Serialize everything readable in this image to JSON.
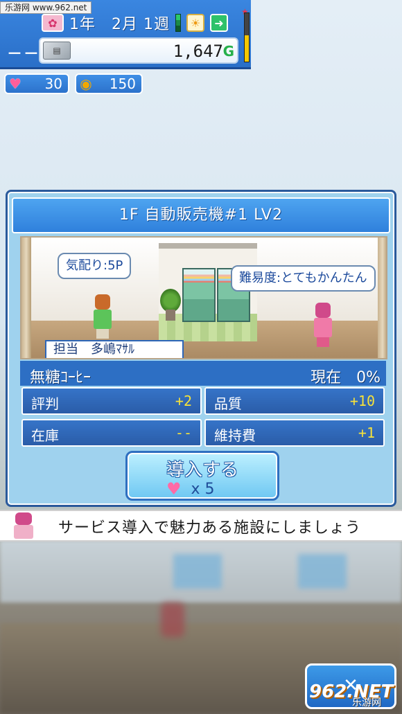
{
  "watermark": {
    "top": "乐游网 www.962.net",
    "bottom": "962.NET",
    "bottom_sub": "乐游网"
  },
  "hud": {
    "date": "1年　2月 1週",
    "money": "1,647",
    "money_unit": "G",
    "dash": "－－",
    "hearts": "30",
    "coins": "150",
    "gauge_level": 0.55
  },
  "dialog": {
    "title": "1F 自動販売機#1 LV2",
    "bubble_staff": "気配り:5P",
    "bubble_customer": "難易度:とてもかんたん",
    "staff_tag": "担当　多嶋ﾏｻﾙ",
    "service_name": "無糖ｺｰﾋｰ",
    "service_status": "現在　0%",
    "stats": [
      {
        "label": "評判",
        "value": "+2"
      },
      {
        "label": "品質",
        "value": "+10"
      },
      {
        "label": "在庫",
        "value": "--"
      },
      {
        "label": "維持費",
        "value": "+1"
      }
    ],
    "button_label": "導入する",
    "button_cost": "x 5"
  },
  "hint": {
    "text": "サービス導入で魅力ある施設にしましょう"
  },
  "colors": {
    "accent": "#2f80dc",
    "value_yellow": "#f6e23a",
    "heart": "#ff5e9a",
    "money_unit": "#26b04a"
  },
  "icons": {
    "money": "wallet-icon",
    "hearts": "heart-icon",
    "coins": "coin-icon",
    "weather": "sun-icon",
    "advance": "arrow-right-icon",
    "season": "flower-icon"
  }
}
